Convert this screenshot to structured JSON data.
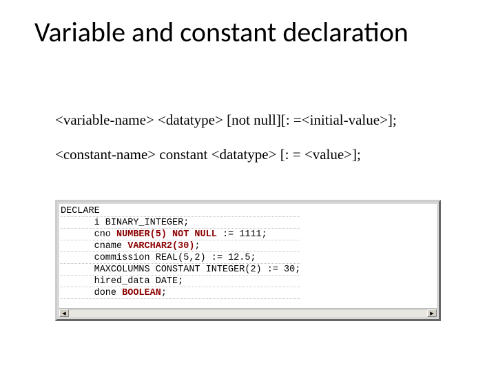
{
  "title": "Variable and constant declaration",
  "syntax": {
    "line1": "<variable-name> <datatype> [not null][: =<initial-value>];",
    "line2": "<constant-name> constant <datatype> [: = <value>];"
  },
  "code_lines": [
    {
      "indent": 0,
      "segments": [
        {
          "t": "DECLARE",
          "kw": false
        }
      ]
    },
    {
      "indent": 1,
      "segments": [
        {
          "t": "i BINARY_INTEGER;",
          "kw": false
        }
      ]
    },
    {
      "indent": 1,
      "segments": [
        {
          "t": "cno ",
          "kw": false
        },
        {
          "t": "NUMBER(5) NOT NULL",
          "kw": true
        },
        {
          "t": " := 1111;",
          "kw": false
        }
      ]
    },
    {
      "indent": 1,
      "segments": [
        {
          "t": "cname ",
          "kw": false
        },
        {
          "t": "VARCHAR2(30)",
          "kw": true
        },
        {
          "t": ";",
          "kw": false
        }
      ]
    },
    {
      "indent": 1,
      "segments": [
        {
          "t": "commission REAL(5,2) := 12.5;",
          "kw": false
        }
      ]
    },
    {
      "indent": 1,
      "segments": [
        {
          "t": "MAXCOLUMNS CONSTANT INTEGER(2) := 30;",
          "kw": false
        }
      ]
    },
    {
      "indent": 1,
      "segments": [
        {
          "t": "hired_data DATE;",
          "kw": false
        }
      ]
    },
    {
      "indent": 1,
      "segments": [
        {
          "t": "done ",
          "kw": false
        },
        {
          "t": "BOOLEAN",
          "kw": true
        },
        {
          "t": ";",
          "kw": false
        }
      ]
    }
  ],
  "scrollbar": {
    "left_arrow": "◀",
    "right_arrow": "▶"
  }
}
